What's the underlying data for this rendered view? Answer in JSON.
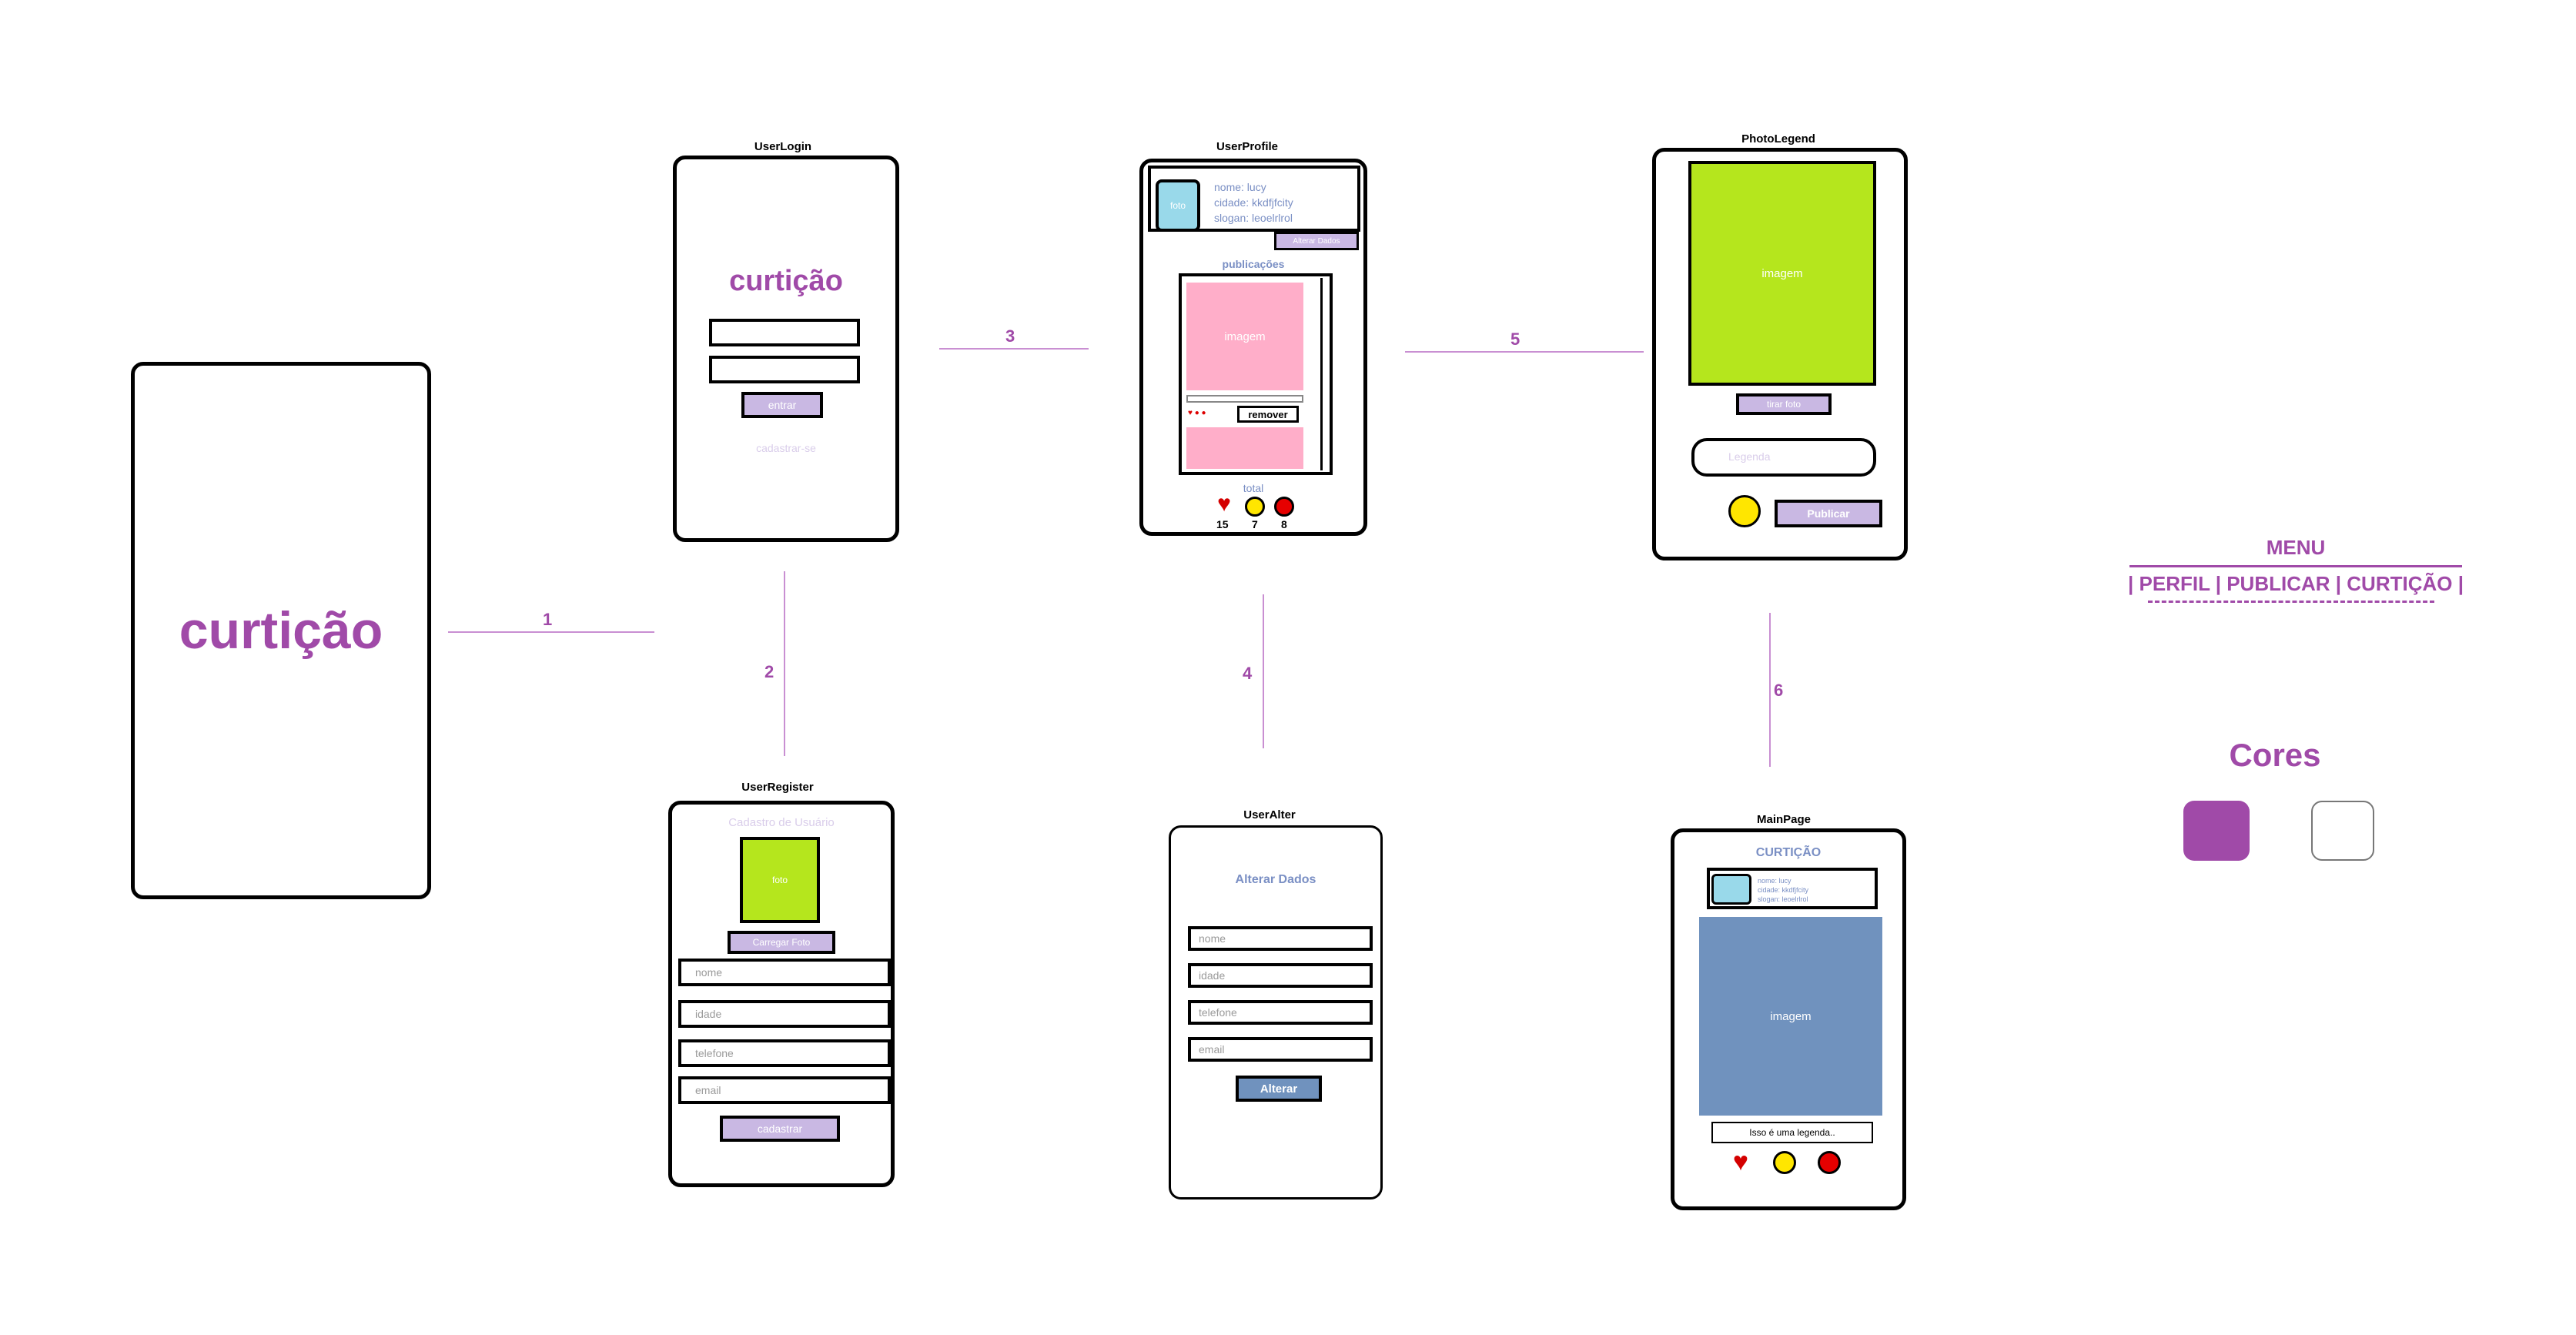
{
  "splash": {
    "logo": "curtição"
  },
  "connectors": [
    "1",
    "2",
    "3",
    "4",
    "5",
    "6"
  ],
  "login": {
    "title": "UserLogin",
    "logo": "curtição",
    "enter": "entrar",
    "register": "cadastrar-se"
  },
  "register": {
    "title": "UserRegister",
    "heading": "Cadastro de Usuário",
    "photo": "foto",
    "upload": "Carregar Foto",
    "fields": [
      "nome",
      "idade",
      "telefone",
      "email"
    ],
    "submit": "cadastrar"
  },
  "profile": {
    "title": "UserProfile",
    "photo": "foto",
    "name": "nome:  lucy",
    "city": "cidade:  kkdfjfcity",
    "slogan": "slogan:   leoelrlrol",
    "edit": "Alterar Dados",
    "posts": "publicações",
    "image": "imagem",
    "remove": "remover",
    "total": "total",
    "counts": [
      "15",
      "7",
      "8"
    ]
  },
  "alter": {
    "title": "UserAlter",
    "heading": "Alterar Dados",
    "fields": [
      "nome",
      "idade",
      "telefone",
      "email"
    ],
    "submit": "Alterar"
  },
  "legend": {
    "title": "PhotoLegend",
    "image": "imagem",
    "take": "tirar foto",
    "caption": "Legenda",
    "publish": "Publicar"
  },
  "main": {
    "title": "MainPage",
    "heading": "CURTIÇÃO",
    "info": [
      "nome:  lucy",
      "cidade:  kkdfjfcity",
      "slogan:   leoelrlrol"
    ],
    "image": "imagem",
    "caption": "Isso é uma legenda.."
  },
  "menu": {
    "title": "MENU",
    "items": "| PERFIL | PUBLICAR | CURTIÇÃO |"
  },
  "colors": {
    "title": "Cores",
    "primary": "#a04aa8",
    "secondary": "#ffffff"
  }
}
